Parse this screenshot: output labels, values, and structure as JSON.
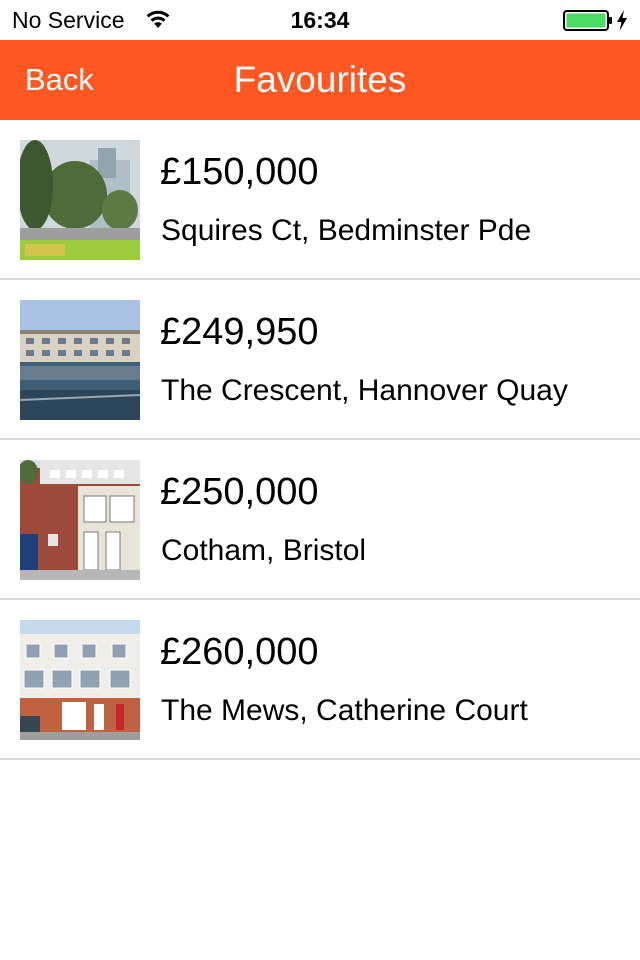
{
  "status_bar": {
    "carrier": "No Service",
    "time": "16:34",
    "battery_color": "#4cd964"
  },
  "nav": {
    "back_label": "Back",
    "title": "Favourites",
    "background_color": "#ff5722"
  },
  "favourites": [
    {
      "price": "£150,000",
      "address": "Squires Ct, Bedminster Pde"
    },
    {
      "price": "£249,950",
      "address": "The Crescent, Hannover Quay"
    },
    {
      "price": "£250,000",
      "address": "Cotham, Bristol"
    },
    {
      "price": "£260,000",
      "address": "The Mews, Catherine Court"
    }
  ]
}
